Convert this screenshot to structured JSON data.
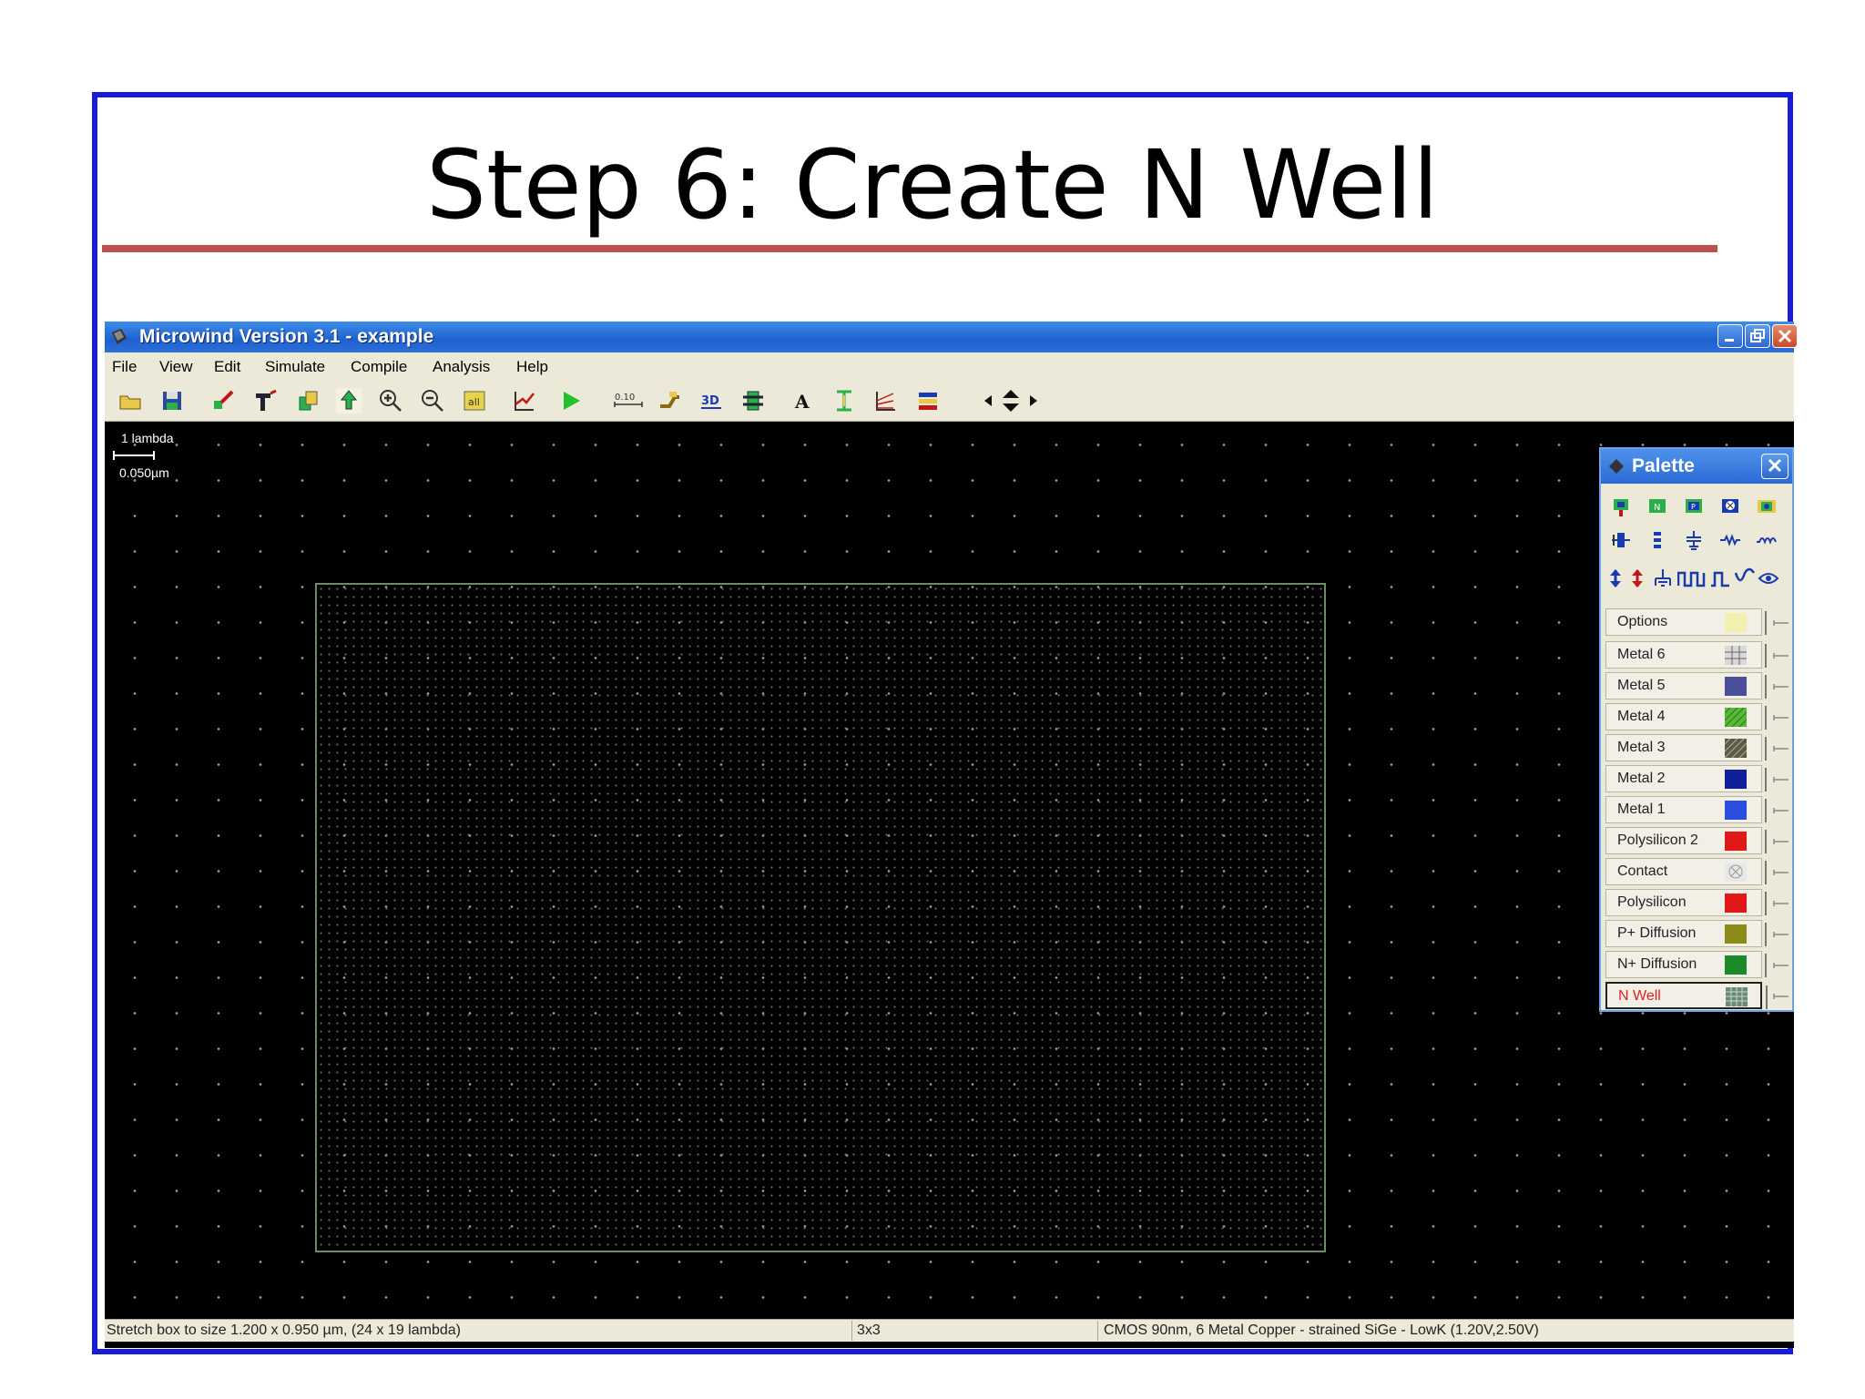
{
  "slide": {
    "title": "Step 6: Create N Well",
    "colors": {
      "frame": "#1a1adc",
      "rule": "#c0504d"
    }
  },
  "window": {
    "title": "Microwind Version 3.1 - example",
    "icon": "microwind-app-icon",
    "controls": [
      "minimize-icon",
      "restore-icon",
      "close-icon"
    ]
  },
  "menu": [
    "File",
    "View",
    "Edit",
    "Simulate",
    "Compile",
    "Analysis",
    "Help"
  ],
  "toolbar": {
    "buttons": [
      "open-folder-icon",
      "save-icon",
      "draw-box-icon",
      "stretch-icon",
      "copy-icon",
      "move-icon",
      "zoom-in-icon",
      "zoom-out-icon",
      "view-all-icon",
      "cross-section-icon",
      "run-simulation-icon",
      "design-rules-icon",
      "connect-icon",
      "3d-view-icon",
      "extract-icon",
      "text-icon",
      "measure-icon",
      "protect-icon",
      "layer-icon",
      "arrow-left-icon",
      "arrow-up-down-icon",
      "arrow-right-icon"
    ],
    "ruler_label": "0.10",
    "view3d_label": "3D"
  },
  "canvas": {
    "scale_top": "1 lambda",
    "scale_bottom": "0.050µm"
  },
  "status": {
    "message": "Stretch box to size 1.200 x 0.950 µm, (24 x 19 lambda)",
    "grid": "3x3",
    "technology": "CMOS 90nm, 6 Metal Copper - strained SiGe - LowK (1.20V,2.50V)"
  },
  "palette": {
    "title": "Palette",
    "icon_rows": [
      [
        "mos-p-icon",
        "mos-n-icon",
        "mos-pn-icon",
        "mos-x-icon",
        "mos-multi-icon"
      ],
      [
        "contact-stack-icon",
        "via-stack-icon",
        "capacitor-icon",
        "resistor-icon",
        "inductor-icon"
      ],
      [
        "vdd-arrow-icon",
        "vss-arrow-icon",
        "ground-icon",
        "clock-icon",
        "pulse-icon",
        "sine-icon",
        "eye-icon"
      ]
    ],
    "layers": [
      {
        "label": "Options",
        "color": "#f2efb0",
        "pattern": "solid"
      },
      {
        "label": "Metal 6",
        "color": "#c8c8c8",
        "pattern": "grid"
      },
      {
        "label": "Metal 5",
        "color": "#4a4f9a",
        "pattern": "solid"
      },
      {
        "label": "Metal 4",
        "color": "#58b838",
        "pattern": "hatch"
      },
      {
        "label": "Metal 3",
        "color": "#5a5a48",
        "pattern": "hatch"
      },
      {
        "label": "Metal 2",
        "color": "#10209a",
        "pattern": "solid"
      },
      {
        "label": "Metal 1",
        "color": "#2a4ee0",
        "pattern": "solid"
      },
      {
        "label": "Polysilicon 2",
        "color": "#e01818",
        "pattern": "solid"
      },
      {
        "label": "Contact",
        "color": "#d8d8d8",
        "pattern": "cross"
      },
      {
        "label": "Polysilicon",
        "color": "#e01818",
        "pattern": "solid"
      },
      {
        "label": "P+ Diffusion",
        "color": "#8c8a18",
        "pattern": "solid"
      },
      {
        "label": "N+ Diffusion",
        "color": "#1c8a2a",
        "pattern": "solid"
      },
      {
        "label": "N Well",
        "color": "#6a8a78",
        "pattern": "grid",
        "selected": true
      }
    ]
  }
}
